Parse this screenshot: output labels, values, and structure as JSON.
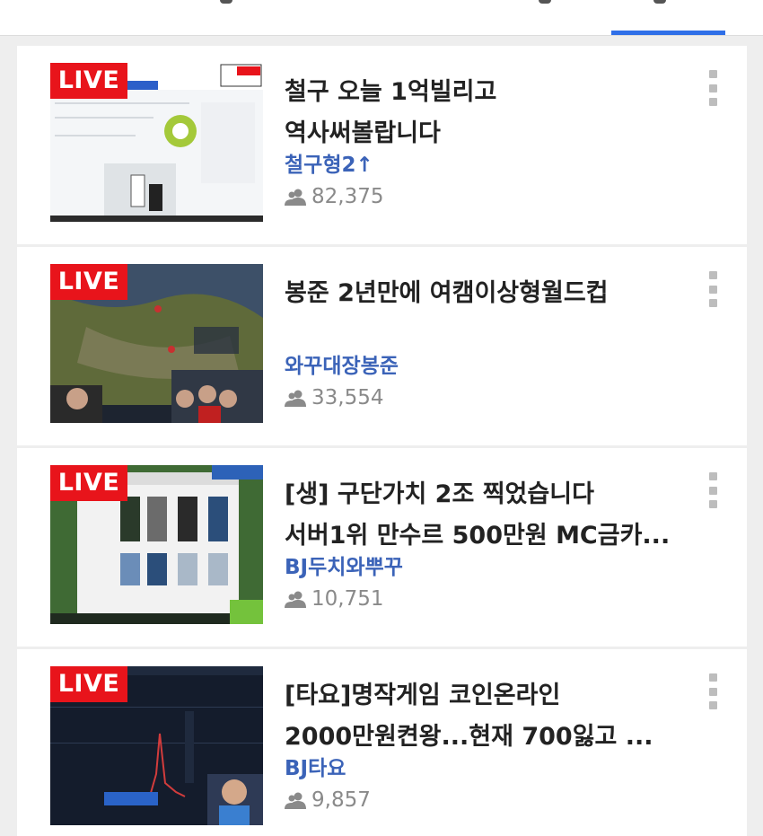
{
  "colors": {
    "accent": "#2f6fe8",
    "live_badge": "#e8141b",
    "channel": "#3b63b8"
  },
  "streams": [
    {
      "live": "LIVE",
      "title": "철구 오늘 1억빌리고 역사써볼랍니다",
      "title_lines": [
        "철구 오늘 1억빌리고",
        "역사써볼랍니다"
      ],
      "channel": "철구형2↑",
      "viewers": "82,375"
    },
    {
      "live": "LIVE",
      "title": "봉준 2년만에 여캠이상형월드컵",
      "title_lines": [
        "봉준 2년만에 여캠이상형월드컵",
        ""
      ],
      "channel": "와꾸대장봉준",
      "viewers": "33,554"
    },
    {
      "live": "LIVE",
      "title": "[생] 구단가치 2조 찍었습니다 서버1위 만수르 500만원 MC금카...",
      "title_lines": [
        "[생] 구단가치 2조 찍었습니다",
        "서버1위 만수르 500만원 MC금카..."
      ],
      "channel": "BJ두치와뿌꾸",
      "viewers": "10,751"
    },
    {
      "live": "LIVE",
      "title": "[타요]명작게임 코인온라인 2000만원켠왕...현재 700잃고 ...",
      "title_lines": [
        "[타요]명작게임 코인온라인",
        "2000만원켠왕...현재 700잃고 ..."
      ],
      "channel": "BJ타요",
      "viewers": "9,857"
    }
  ]
}
